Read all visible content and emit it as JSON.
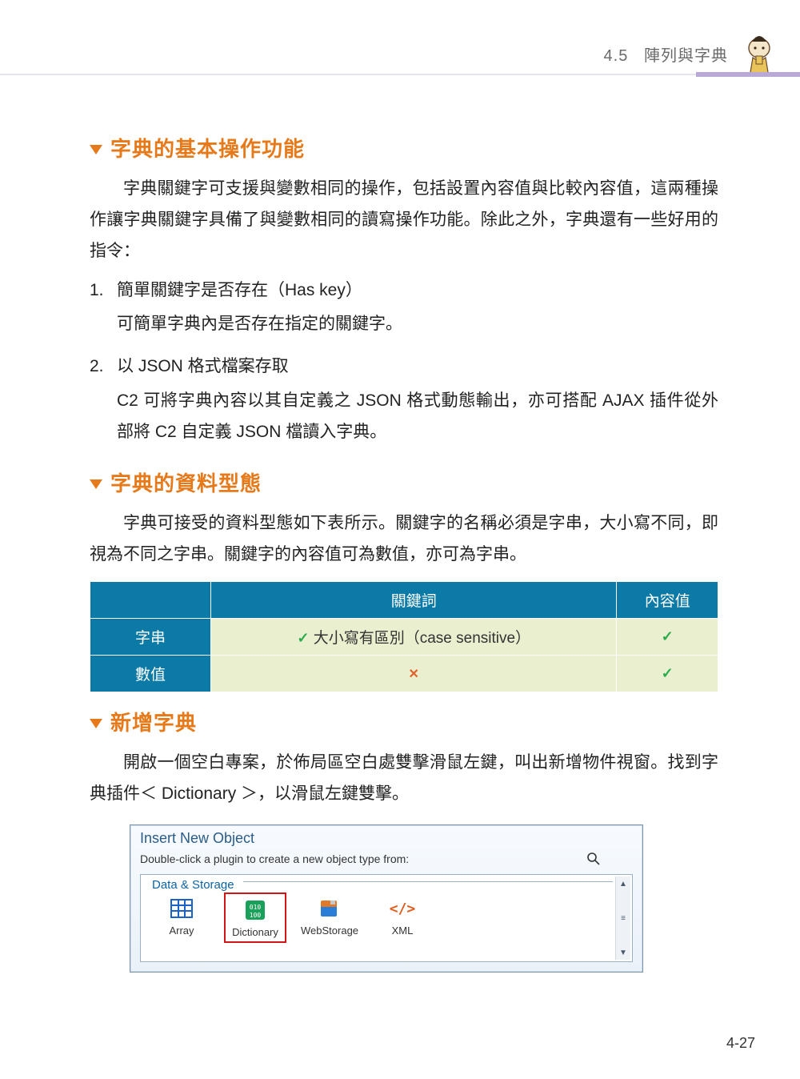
{
  "header": {
    "section_number": "4.5",
    "section_title": "陣列與字典"
  },
  "sections": {
    "s1": {
      "title": "字典的基本操作功能",
      "p1": "字典關鍵字可支援與變數相同的操作，包括設置內容值與比較內容值，這兩種操作讓字典關鍵字具備了與變數相同的讀寫操作功能。除此之外，字典還有一些好用的指令：",
      "item1_num": "1.",
      "item1_title": "簡單關鍵字是否存在（Has key）",
      "item1_sub": "可簡單字典內是否存在指定的關鍵字。",
      "item2_num": "2.",
      "item2_title": "以 JSON 格式檔案存取",
      "item2_sub": "C2 可將字典內容以其自定義之 JSON 格式動態輸出，亦可搭配 AJAX 插件從外部將 C2 自定義 JSON 檔讀入字典。"
    },
    "s2": {
      "title": "字典的資料型態",
      "p1": "字典可接受的資料型態如下表所示。關鍵字的名稱必須是字串，大小寫不同，即視為不同之字串。關鍵字的內容值可為數值，亦可為字串。",
      "table": {
        "head_blank": "",
        "head_key": "關鍵詞",
        "head_val": "內容值",
        "row_string": "字串",
        "row_string_key": "大小寫有區別（case sensitive）",
        "row_number": "數值"
      }
    },
    "s3": {
      "title": "新增字典",
      "p1": "開啟一個空白專案，於佈局區空白處雙擊滑鼠左鍵，叫出新增物件視窗。找到字典插件＜ Dictionary ＞，以滑鼠左鍵雙擊。"
    }
  },
  "dialog": {
    "title": "Insert New Object",
    "subtitle": "Double-click a plugin to create a new object type from:",
    "group": "Data & Storage",
    "items": {
      "array": "Array",
      "dictionary": "Dictionary",
      "webstorage": "WebStorage",
      "xml": "XML"
    }
  },
  "page_number": "4-27"
}
